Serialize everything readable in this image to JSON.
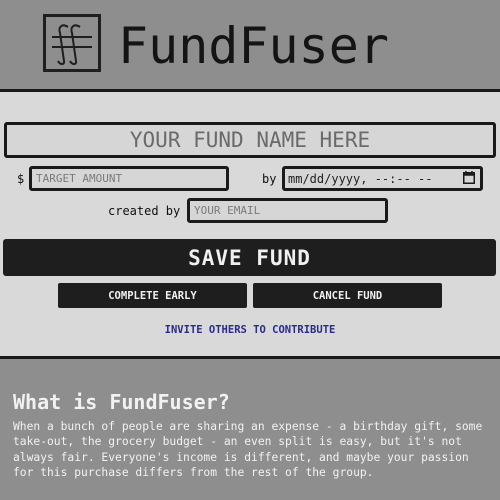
{
  "header": {
    "logo_icon": "ff-monogram-logo-icon",
    "title": "FundFuser"
  },
  "form": {
    "fund_name_placeholder": "YOUR FUND NAME HERE",
    "currency_symbol": "$",
    "target_amount_placeholder": "TARGET AMOUNT",
    "by_label": "by",
    "date_placeholder": "mm/dd/yyyy, --:-- --",
    "calendar_icon": "calendar-icon",
    "created_by_label": "created by",
    "email_placeholder": "YOUR EMAIL",
    "save_label": "SAVE FUND",
    "complete_early_label": "COMPLETE EARLY",
    "cancel_label": "CANCEL FUND",
    "invite_label": "INVITE OTHERS TO CONTRIBUTE"
  },
  "about": {
    "title": "What is FundFuser?",
    "body": "When a bunch of people are sharing an expense - a birthday gift, some take-out, the grocery budget - an even split is easy, but it's not always fair. Everyone's income is different, and maybe your passion for this purchase differs from the rest of the group."
  },
  "colors": {
    "background": "#8e8e8e",
    "panel": "#d9d9d9",
    "button": "#1e1e1e",
    "link": "#2b2b8a"
  }
}
